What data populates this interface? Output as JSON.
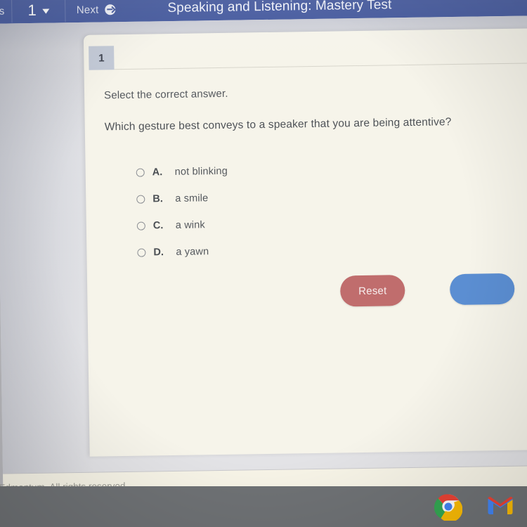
{
  "navbar": {
    "previous_label": "us",
    "page_number": "1",
    "next_label": "Next",
    "title": "Speaking and Listening: Mastery Test",
    "caret_icon": "chevron-down-icon",
    "next_icon": "arrow-right-circle-icon",
    "background_color": "#41569c"
  },
  "question": {
    "number": "1",
    "prompt": "Select the correct answer.",
    "text": "Which gesture best conveys to a speaker that you are being attentive?",
    "badge_color": "#c3cad7",
    "options": [
      {
        "letter": "A.",
        "label": "not blinking",
        "selected": false
      },
      {
        "letter": "B.",
        "label": "a smile",
        "selected": false
      },
      {
        "letter": "C.",
        "label": "a wink",
        "selected": false
      },
      {
        "letter": "D.",
        "label": "a yawn",
        "selected": false
      }
    ]
  },
  "actions": {
    "reset_label": "Reset",
    "reset_color": "#c06d6d",
    "submit_label": "",
    "submit_color": "#5b8ed2"
  },
  "footer": {
    "text": "Edmentum. All rights reserved."
  },
  "taskbar": {
    "background_color": "#6f7275",
    "icons": [
      {
        "name": "chrome-icon"
      },
      {
        "name": "gmail-icon"
      }
    ]
  }
}
